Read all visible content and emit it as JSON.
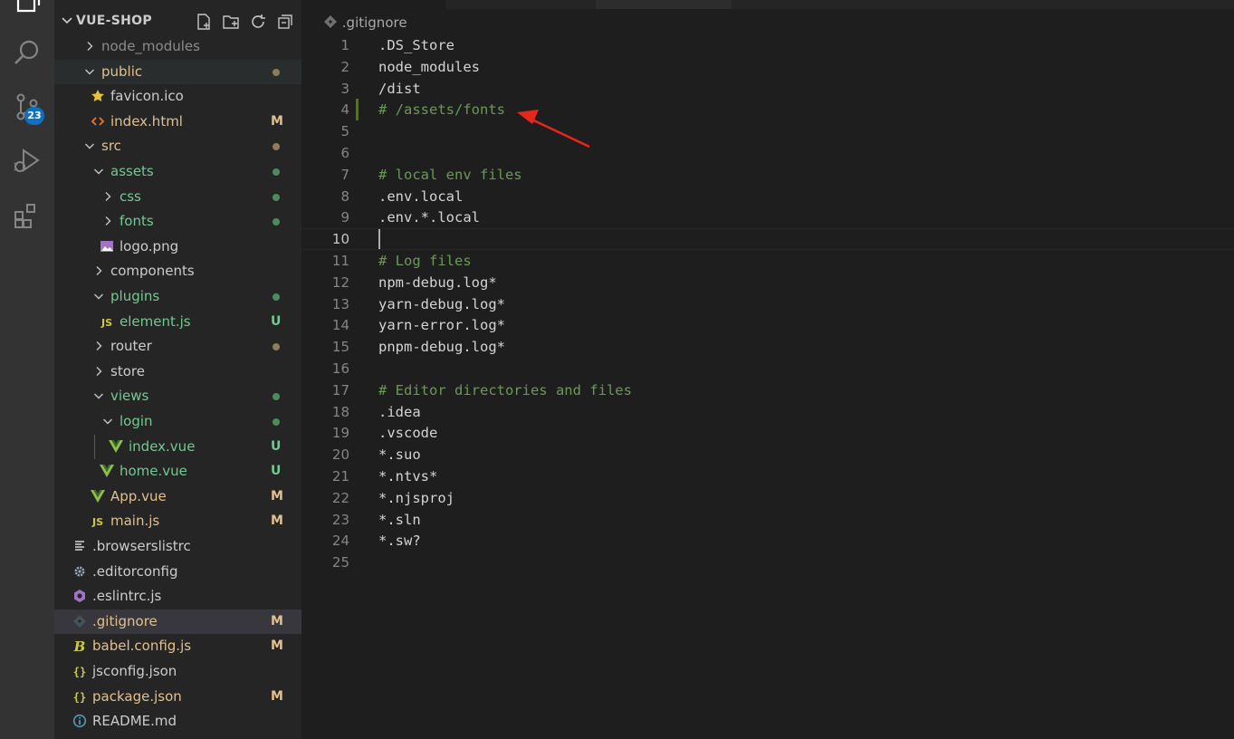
{
  "explorer": {
    "title": "VUE-SHOP",
    "tree": [
      {
        "name": "node_modules",
        "kind": "folder",
        "open": false,
        "status": "",
        "status_kind": "ign",
        "label_kind": "ign",
        "icon": ""
      },
      {
        "name": "public",
        "kind": "folder",
        "open": true,
        "status": "",
        "status_kind": "mod-dot",
        "label_kind": "mod",
        "icon": ""
      },
      {
        "name": "favicon.ico",
        "kind": "file",
        "status": "",
        "status_kind": "",
        "label_kind": "def",
        "icon": "star-icon"
      },
      {
        "name": "index.html",
        "kind": "file",
        "status": "M",
        "status_kind": "mod",
        "label_kind": "mod",
        "icon": "html-icon"
      },
      {
        "name": "src",
        "kind": "folder",
        "open": true,
        "status": "",
        "status_kind": "mod-dot",
        "label_kind": "mod",
        "icon": ""
      },
      {
        "name": "assets",
        "kind": "folder",
        "open": true,
        "status": "",
        "status_kind": "untr-dot",
        "label_kind": "untr",
        "icon": ""
      },
      {
        "name": "css",
        "kind": "folder",
        "open": false,
        "status": "",
        "status_kind": "untr-dot",
        "label_kind": "untr",
        "icon": ""
      },
      {
        "name": "fonts",
        "kind": "folder",
        "open": false,
        "status": "",
        "status_kind": "untr-dot",
        "label_kind": "untr",
        "icon": ""
      },
      {
        "name": "logo.png",
        "kind": "file",
        "status": "",
        "status_kind": "",
        "label_kind": "def",
        "icon": "image-icon"
      },
      {
        "name": "components",
        "kind": "folder",
        "open": false,
        "status": "",
        "status_kind": "",
        "label_kind": "def",
        "icon": ""
      },
      {
        "name": "plugins",
        "kind": "folder",
        "open": true,
        "status": "",
        "status_kind": "untr-dot",
        "label_kind": "untr",
        "icon": ""
      },
      {
        "name": "element.js",
        "kind": "file",
        "status": "U",
        "status_kind": "untr",
        "label_kind": "untr",
        "icon": "js-icon"
      },
      {
        "name": "router",
        "kind": "folder",
        "open": false,
        "status": "",
        "status_kind": "mod-dot",
        "label_kind": "def",
        "icon": ""
      },
      {
        "name": "store",
        "kind": "folder",
        "open": false,
        "status": "",
        "status_kind": "",
        "label_kind": "def",
        "icon": ""
      },
      {
        "name": "views",
        "kind": "folder",
        "open": true,
        "status": "",
        "status_kind": "untr-dot",
        "label_kind": "untr",
        "icon": ""
      },
      {
        "name": "login",
        "kind": "folder",
        "open": true,
        "status": "",
        "status_kind": "untr-dot",
        "label_kind": "untr",
        "icon": ""
      },
      {
        "name": "index.vue",
        "kind": "file",
        "status": "U",
        "status_kind": "untr",
        "label_kind": "untr",
        "icon": "vue-icon"
      },
      {
        "name": "home.vue",
        "kind": "file",
        "status": "U",
        "status_kind": "untr",
        "label_kind": "untr",
        "icon": "vue-icon"
      },
      {
        "name": "App.vue",
        "kind": "file",
        "status": "M",
        "status_kind": "mod",
        "label_kind": "mod",
        "icon": "vue-icon"
      },
      {
        "name": "main.js",
        "kind": "file",
        "status": "M",
        "status_kind": "mod",
        "label_kind": "mod",
        "icon": "js-icon"
      },
      {
        "name": ".browserslistrc",
        "kind": "file",
        "status": "",
        "status_kind": "",
        "label_kind": "def",
        "icon": "lines-icon"
      },
      {
        "name": ".editorconfig",
        "kind": "file",
        "status": "",
        "status_kind": "",
        "label_kind": "def",
        "icon": "gear-icon"
      },
      {
        "name": ".eslintrc.js",
        "kind": "file",
        "status": "",
        "status_kind": "",
        "label_kind": "def",
        "icon": "eslint-icon"
      },
      {
        "name": ".gitignore",
        "kind": "file",
        "status": "M",
        "status_kind": "mod",
        "label_kind": "mod",
        "icon": "git-icon",
        "selected": true
      },
      {
        "name": "babel.config.js",
        "kind": "file",
        "status": "M",
        "status_kind": "mod",
        "label_kind": "mod",
        "icon": "babel-icon"
      },
      {
        "name": "jsconfig.json",
        "kind": "file",
        "status": "",
        "status_kind": "",
        "label_kind": "def",
        "icon": "json-icon"
      },
      {
        "name": "package.json",
        "kind": "file",
        "status": "M",
        "status_kind": "mod",
        "label_kind": "mod",
        "icon": "json-icon"
      },
      {
        "name": "README.md",
        "kind": "file",
        "status": "",
        "status_kind": "",
        "label_kind": "def",
        "icon": "info-icon"
      }
    ]
  },
  "activity": {
    "scm_badge": "23"
  },
  "editor": {
    "breadcrumb": ".gitignore",
    "current_line": 10,
    "modified_line": 4,
    "lines": [
      {
        "n": "1",
        "text": ".DS_Store",
        "comment": false
      },
      {
        "n": "2",
        "text": "node_modules",
        "comment": false
      },
      {
        "n": "3",
        "text": "/dist",
        "comment": false
      },
      {
        "n": "4",
        "text": "# /assets/fonts",
        "comment": true
      },
      {
        "n": "5",
        "text": "",
        "comment": false
      },
      {
        "n": "6",
        "text": "",
        "comment": false
      },
      {
        "n": "7",
        "text": "# local env files",
        "comment": true
      },
      {
        "n": "8",
        "text": ".env.local",
        "comment": false
      },
      {
        "n": "9",
        "text": ".env.*.local",
        "comment": false
      },
      {
        "n": "10",
        "text": "",
        "comment": false
      },
      {
        "n": "11",
        "text": "# Log files",
        "comment": true
      },
      {
        "n": "12",
        "text": "npm-debug.log*",
        "comment": false
      },
      {
        "n": "13",
        "text": "yarn-debug.log*",
        "comment": false
      },
      {
        "n": "14",
        "text": "yarn-error.log*",
        "comment": false
      },
      {
        "n": "15",
        "text": "pnpm-debug.log*",
        "comment": false
      },
      {
        "n": "16",
        "text": "",
        "comment": false
      },
      {
        "n": "17",
        "text": "# Editor directories and files",
        "comment": true
      },
      {
        "n": "18",
        "text": ".idea",
        "comment": false
      },
      {
        "n": "19",
        "text": ".vscode",
        "comment": false
      },
      {
        "n": "20",
        "text": "*.suo",
        "comment": false
      },
      {
        "n": "21",
        "text": "*.ntvs*",
        "comment": false
      },
      {
        "n": "22",
        "text": "*.njsproj",
        "comment": false
      },
      {
        "n": "23",
        "text": "*.sln",
        "comment": false
      },
      {
        "n": "24",
        "text": "*.sw?",
        "comment": false
      },
      {
        "n": "25",
        "text": "",
        "comment": false
      }
    ]
  },
  "colors": {
    "modified": "#e2c08d",
    "untracked": "#73c991",
    "comment": "#6a9955",
    "annotation_arrow": "#e8261c"
  }
}
